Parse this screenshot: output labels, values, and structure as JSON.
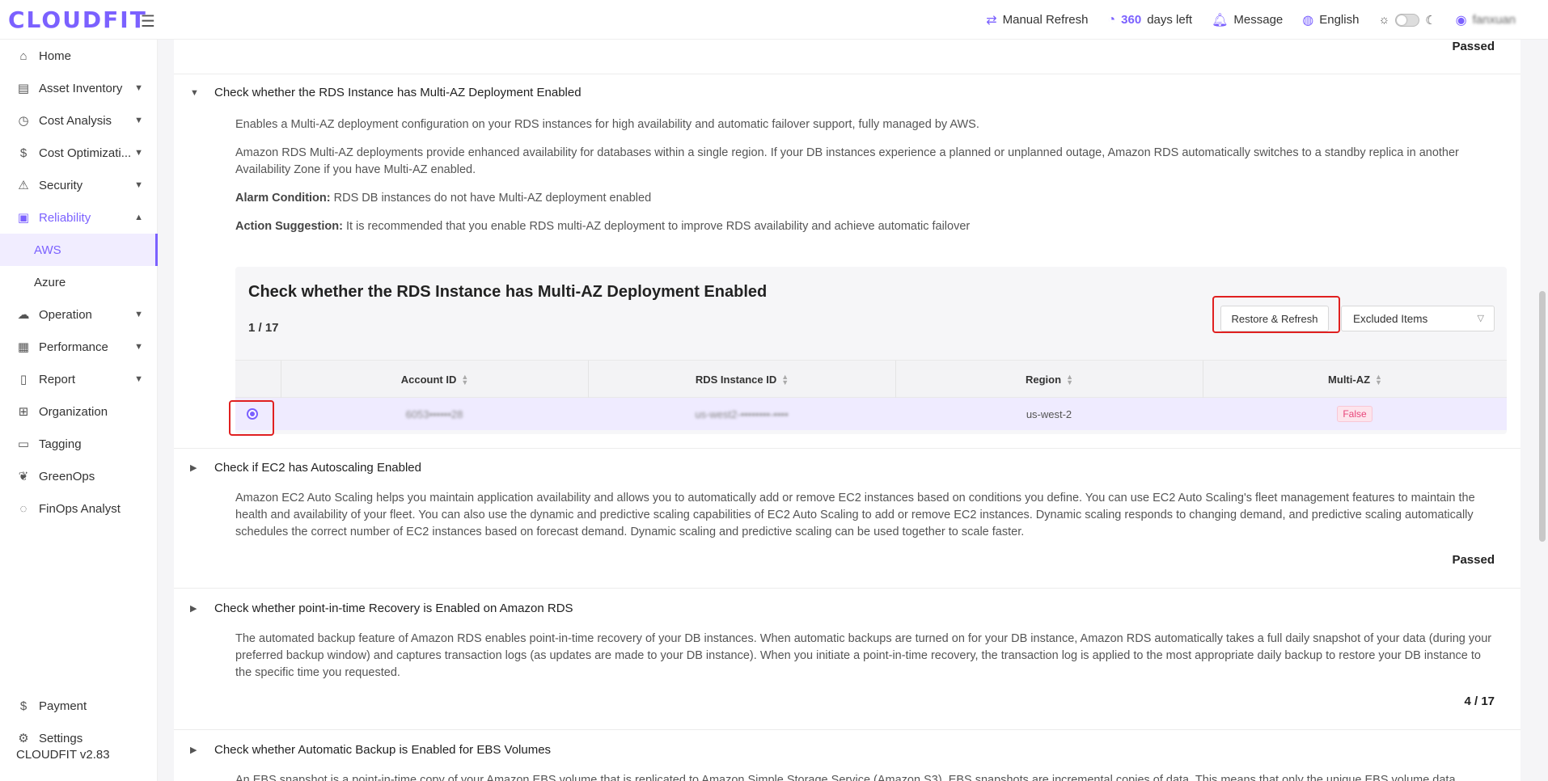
{
  "app": {
    "logo": "CLOUDFIT",
    "version": "CLOUDFIT v2.83"
  },
  "header": {
    "manual_refresh": "Manual Refresh",
    "days_count": "360",
    "days_suffix": "days left",
    "message": "Message",
    "language": "English",
    "user": "fanxuan"
  },
  "sidebar": {
    "items": [
      {
        "label": "Home",
        "icon": "home-icon"
      },
      {
        "label": "Asset Inventory",
        "icon": "inventory-icon"
      },
      {
        "label": "Cost Analysis",
        "icon": "chart-icon"
      },
      {
        "label": "Cost Optimizati...",
        "icon": "dollar-icon"
      },
      {
        "label": "Security",
        "icon": "alarm-icon"
      },
      {
        "label": "Reliability",
        "icon": "reliability-icon"
      },
      {
        "label": "Operation",
        "icon": "cloud-icon"
      },
      {
        "label": "Performance",
        "icon": "performance-icon"
      },
      {
        "label": "Report",
        "icon": "report-icon"
      },
      {
        "label": "Organization",
        "icon": "org-icon"
      },
      {
        "label": "Tagging",
        "icon": "tag-icon"
      },
      {
        "label": "GreenOps",
        "icon": "leaf-icon"
      },
      {
        "label": "FinOps Analyst",
        "icon": "analyst-icon"
      }
    ],
    "sub_items": [
      "AWS",
      "Azure"
    ],
    "bottom": [
      {
        "label": "Payment",
        "icon": "dollar-icon"
      },
      {
        "label": "Settings",
        "icon": "gear-icon"
      }
    ]
  },
  "content": {
    "top_status": "Passed",
    "section1": {
      "title": "Check whether the RDS Instance has Multi-AZ Deployment Enabled",
      "desc1": "Enables a Multi-AZ deployment configuration on your RDS instances for high availability and automatic failover support, fully managed by AWS.",
      "desc2": "Amazon RDS Multi-AZ deployments provide enhanced availability for databases within a single region. If your DB instances experience a planned or unplanned outage, Amazon RDS automatically switches to a standby replica in another Availability Zone if you have Multi-AZ enabled.",
      "alarm_label": "Alarm Condition:",
      "alarm_text": "RDS DB instances do not have Multi-AZ deployment enabled",
      "action_label": "Action Suggestion:",
      "action_text": "It is recommended that you enable RDS multi-AZ deployment to improve RDS availability and achieve automatic failover",
      "panel": {
        "title": "Check whether the RDS Instance has Multi-AZ Deployment Enabled",
        "count": "1 / 17",
        "restore_button": "Restore & Refresh",
        "excluded_select": "Excluded Items",
        "columns": [
          "Account ID",
          "RDS Instance ID",
          "Region",
          "Multi-AZ"
        ],
        "row": {
          "account_id": "6053••••••28",
          "instance_id": "us-west2-••••••••-••••",
          "region": "us-west-2",
          "multi_az": "False"
        }
      }
    },
    "section2": {
      "title": "Check if EC2 has Autoscaling Enabled",
      "desc": "Amazon EC2 Auto Scaling helps you maintain application availability and allows you to automatically add or remove EC2 instances based on conditions you define. You can use EC2 Auto Scaling's fleet management features to maintain the health and availability of your fleet. You can also use the dynamic and predictive scaling capabilities of EC2 Auto Scaling to add or remove EC2 instances. Dynamic scaling responds to changing demand, and predictive scaling automatically schedules the correct number of EC2 instances based on forecast demand. Dynamic scaling and predictive scaling can be used together to scale faster.",
      "status": "Passed"
    },
    "section3": {
      "title": "Check whether point-in-time Recovery is Enabled on Amazon RDS",
      "desc": "The automated backup feature of Amazon RDS enables point-in-time recovery of your DB instances. When automatic backups are turned on for your DB instance, Amazon RDS automatically takes a full daily snapshot of your data (during your preferred backup window) and captures transaction logs (as updates are made to your DB instance). When you initiate a point-in-time recovery, the transaction log is applied to the most appropriate daily backup to restore your DB instance to the specific time you requested.",
      "status": "4 / 17"
    },
    "section4": {
      "title": "Check whether Automatic Backup is Enabled for EBS Volumes",
      "desc": "An EBS snapshot is a point-in-time copy of your Amazon EBS volume that is replicated to Amazon Simple Storage Service (Amazon S3). EBS snapshots are incremental copies of data. This means that only the unique EBS volume data"
    }
  },
  "colors": {
    "accent": "#7b61ff",
    "highlight": "#e02020",
    "false_badge": "#e8457a"
  }
}
